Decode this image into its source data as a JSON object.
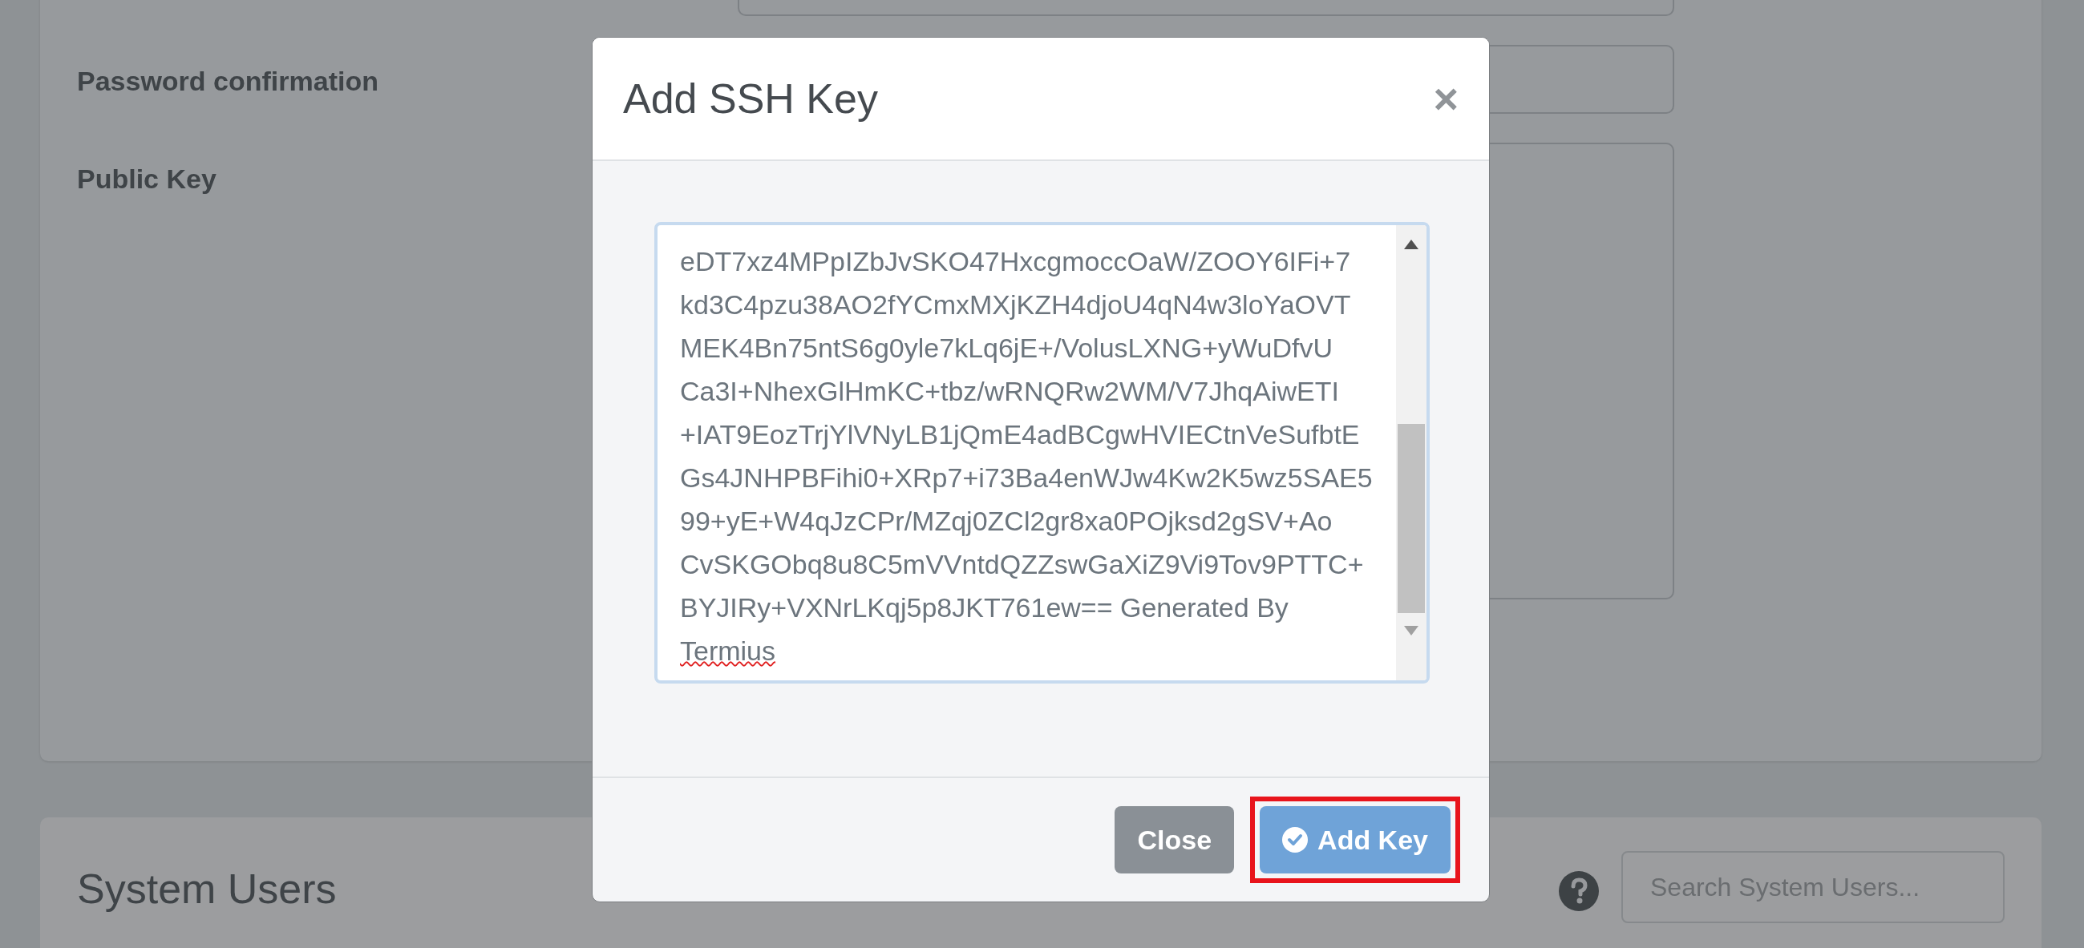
{
  "form": {
    "fields": [
      {
        "kind": "input"
      },
      {
        "kind": "input",
        "label": "Password confirmation"
      },
      {
        "kind": "textarea",
        "label": "Public Key"
      }
    ]
  },
  "section": {
    "title": "System Users",
    "search": {
      "placeholder": "Search System Users..."
    }
  },
  "modal": {
    "title": "Add SSH Key",
    "close": "×",
    "key_lines": [
      "eDT7xz4MPpIZbJvSKO47HxcgmoccOaW/ZOOY6IFi+7",
      "kd3C4pzu38AO2fYCmxMXjKZH4djoU4qN4w3loYaOVT",
      "MEK4Bn75ntS6g0yle7kLq6jE+/VolusLXNG+yWuDfvU",
      "Ca3I+NhexGlHmKC+tbz/wRNQRw2WM/V7JhqAiwETI",
      "+IAT9EozTrjYlVNyLB1jQmE4adBCgwHVIECtnVeSufbtE",
      "Gs4JNHPBFihi0+XRp7+i73Ba4enWJw4Kw2K5wz5SAE5",
      "99+yE+W4qJzCPr/MZqj0ZCl2gr8xa0POjksd2gSV+Ao",
      "CvSKGObq8u8C5mVVntdQZZswGaXiZ9Vi9Tov9PTTC+",
      "BYJIRy+VXNrLKqj5p8JKT761ew== Generated By",
      "Termius"
    ],
    "buttons": [
      {
        "kind": "secondary",
        "label": "Close",
        "highlighted": false
      },
      {
        "kind": "primary",
        "label": "Add Key",
        "highlighted": true
      }
    ]
  }
}
